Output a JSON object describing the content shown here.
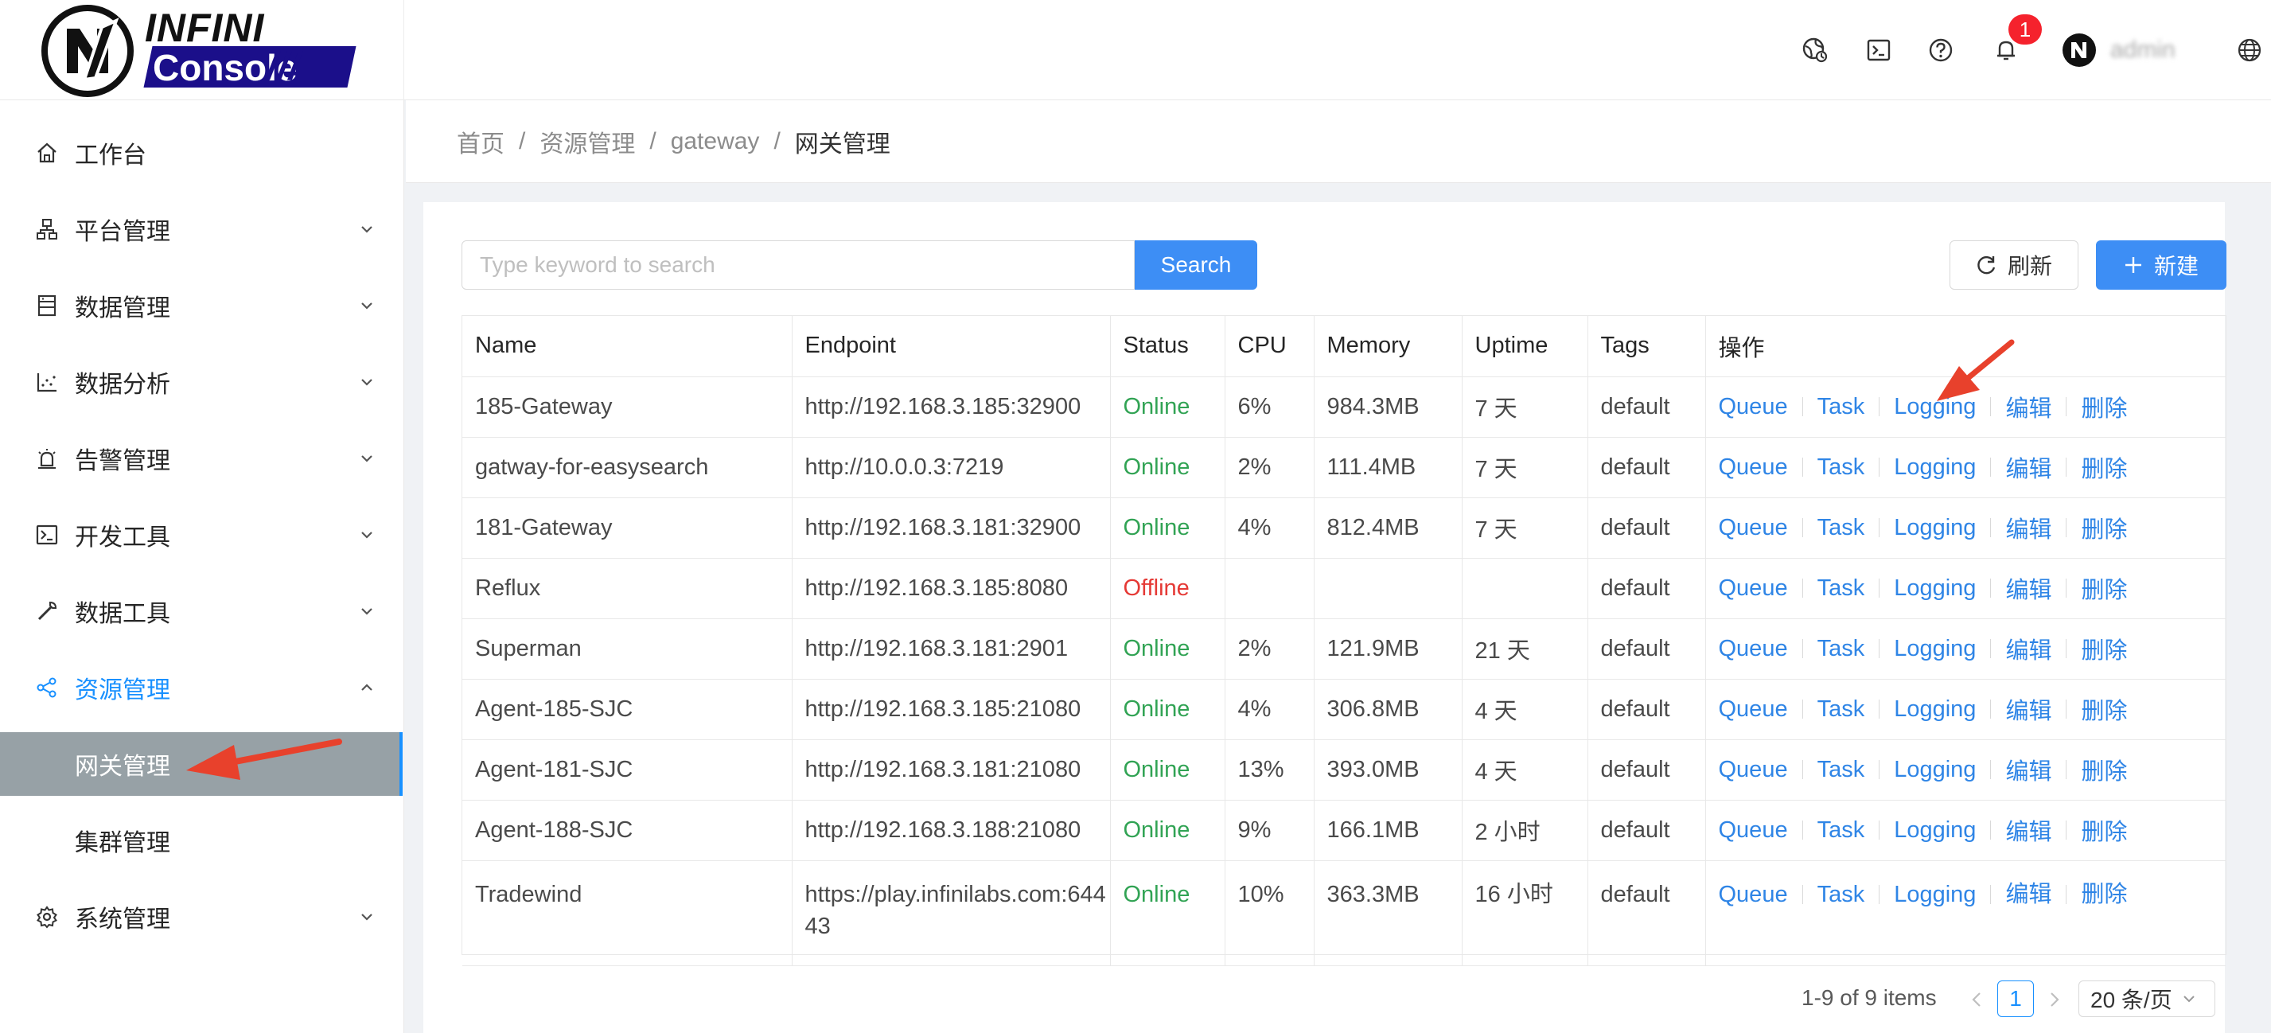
{
  "brand": {
    "word1": "INFINI",
    "word2": "Console",
    "slashes": "///"
  },
  "header": {
    "notification_count": "1",
    "username": "admin"
  },
  "sidebar": {
    "items": [
      {
        "label": "工作台",
        "icon": "home-icon"
      },
      {
        "label": "平台管理",
        "icon": "cluster-icon"
      },
      {
        "label": "数据管理",
        "icon": "database-icon"
      },
      {
        "label": "数据分析",
        "icon": "chart-icon"
      },
      {
        "label": "告警管理",
        "icon": "alarm-icon"
      },
      {
        "label": "开发工具",
        "icon": "terminal-icon"
      },
      {
        "label": "数据工具",
        "icon": "wrench-icon"
      },
      {
        "label": "资源管理",
        "icon": "share-icon"
      },
      {
        "label": "系统管理",
        "icon": "gear-icon"
      }
    ],
    "sub_items": [
      {
        "label": "网关管理"
      },
      {
        "label": "集群管理"
      }
    ]
  },
  "breadcrumb": [
    "首页",
    "资源管理",
    "gateway",
    "网关管理"
  ],
  "toolbar": {
    "search_placeholder": "Type keyword to search",
    "search_label": "Search",
    "refresh_label": "刷新",
    "new_label": "新建"
  },
  "table": {
    "columns": [
      "Name",
      "Endpoint",
      "Status",
      "CPU",
      "Memory",
      "Uptime",
      "Tags",
      "操作"
    ],
    "actions": [
      "Queue",
      "Task",
      "Logging",
      "编辑",
      "删除"
    ],
    "rows": [
      {
        "name": "185-Gateway",
        "endpoint": "http://192.168.3.185:32900",
        "status": "Online",
        "cpu": "6%",
        "memory": "984.3MB",
        "uptime": "7 天",
        "tags": "default"
      },
      {
        "name": "gatway-for-easysearch",
        "endpoint": "http://10.0.0.3:7219",
        "status": "Online",
        "cpu": "2%",
        "memory": "111.4MB",
        "uptime": "7 天",
        "tags": "default"
      },
      {
        "name": "181-Gateway",
        "endpoint": "http://192.168.3.181:32900",
        "status": "Online",
        "cpu": "4%",
        "memory": "812.4MB",
        "uptime": "7 天",
        "tags": "default"
      },
      {
        "name": "Reflux",
        "endpoint": "http://192.168.3.185:8080",
        "status": "Offline",
        "cpu": "",
        "memory": "",
        "uptime": "",
        "tags": "default"
      },
      {
        "name": "Superman",
        "endpoint": "http://192.168.3.181:2901",
        "status": "Online",
        "cpu": "2%",
        "memory": "121.9MB",
        "uptime": "21 天",
        "tags": "default"
      },
      {
        "name": "Agent-185-SJC",
        "endpoint": "http://192.168.3.185:21080",
        "status": "Online",
        "cpu": "4%",
        "memory": "306.8MB",
        "uptime": "4 天",
        "tags": "default"
      },
      {
        "name": "Agent-181-SJC",
        "endpoint": "http://192.168.3.181:21080",
        "status": "Online",
        "cpu": "13%",
        "memory": "393.0MB",
        "uptime": "4 天",
        "tags": "default"
      },
      {
        "name": "Agent-188-SJC",
        "endpoint": "http://192.168.3.188:21080",
        "status": "Online",
        "cpu": "9%",
        "memory": "166.1MB",
        "uptime": "2 小时",
        "tags": "default"
      },
      {
        "name": "Tradewind",
        "endpoint": "https://play.infinilabs.com:64443",
        "status": "Online",
        "cpu": "10%",
        "memory": "363.3MB",
        "uptime": "16 小时",
        "tags": "default"
      }
    ]
  },
  "pagination": {
    "summary": "1-9 of 9 items",
    "current_page": "1",
    "page_size": "20 条/页"
  },
  "colors": {
    "primary": "#3d8ef5",
    "online": "#31a354",
    "offline": "#e53935",
    "link": "#2f85e6",
    "annotation": "#e8412c"
  }
}
